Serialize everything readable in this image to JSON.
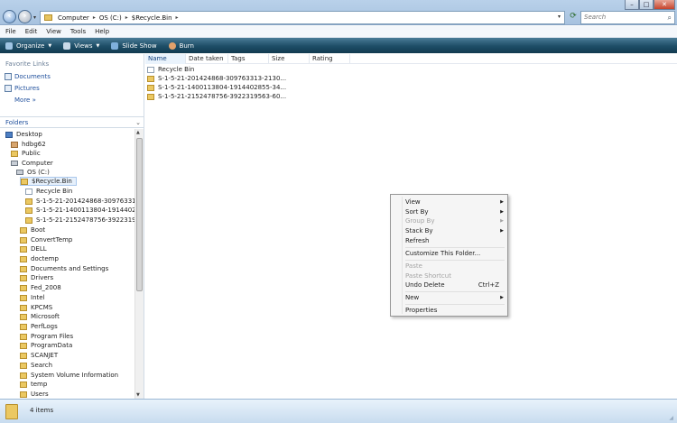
{
  "window": {
    "controls": {
      "minimize": "–",
      "maximize": "□",
      "close": "✕"
    }
  },
  "address": {
    "back_icon": "back-arrow-icon",
    "forward_icon": "forward-arrow-icon",
    "crumbs": [
      "Computer",
      "OS (C:)",
      "$Recycle.Bin"
    ],
    "search_placeholder": "Search"
  },
  "menubar": [
    "File",
    "Edit",
    "View",
    "Tools",
    "Help"
  ],
  "toolbar": {
    "organize": "Organize",
    "views": "Views",
    "slideshow": "Slide Show",
    "burn": "Burn"
  },
  "favorites": {
    "title": "Favorite Links",
    "items": [
      "Documents",
      "Pictures"
    ],
    "more": "More »"
  },
  "folders": {
    "title": "Folders",
    "chevron": "⌄",
    "tree": [
      "Desktop",
      "hdbg62",
      "Public",
      "Computer",
      "OS (C:)",
      "$Recycle.Bin",
      "Recycle Bin",
      "S-1-5-21-201424868-309763313-2130",
      "S-1-5-21-1400113804-1914402855-34",
      "S-1-5-21-2152478756-3922319563-60",
      "Boot",
      "ConvertTemp",
      "DELL",
      "doctemp",
      "Documents and Settings",
      "Drivers",
      "Fed_2008",
      "Intel",
      "KPCMS",
      "Microsoft",
      "PerfLogs",
      "Program Files",
      "ProgramData",
      "SCANJET",
      "Search",
      "System Volume Information",
      "temp",
      "Users"
    ]
  },
  "columns": [
    "Name",
    "Date taken",
    "Tags",
    "Size",
    "Rating"
  ],
  "files": [
    "Recycle Bin",
    "S-1-5-21-201424868-309763313-2130...",
    "S-1-5-21-1400113804-1914402855-34...",
    "S-1-5-21-2152478756-3922319563-60..."
  ],
  "context_menu": {
    "view": "View",
    "sort_by": "Sort By",
    "group_by": "Group By",
    "stack_by": "Stack By",
    "refresh": "Refresh",
    "customize": "Customize This Folder...",
    "paste": "Paste",
    "paste_shortcut": "Paste Shortcut",
    "undo_delete": "Undo Delete",
    "undo_shortcut": "Ctrl+Z",
    "new": "New",
    "properties": "Properties"
  },
  "status": {
    "item_count": "4 items"
  },
  "colors": {
    "toolbar": "#1d4d66",
    "link": "#1f4f9c",
    "folder": "#ebc862"
  }
}
